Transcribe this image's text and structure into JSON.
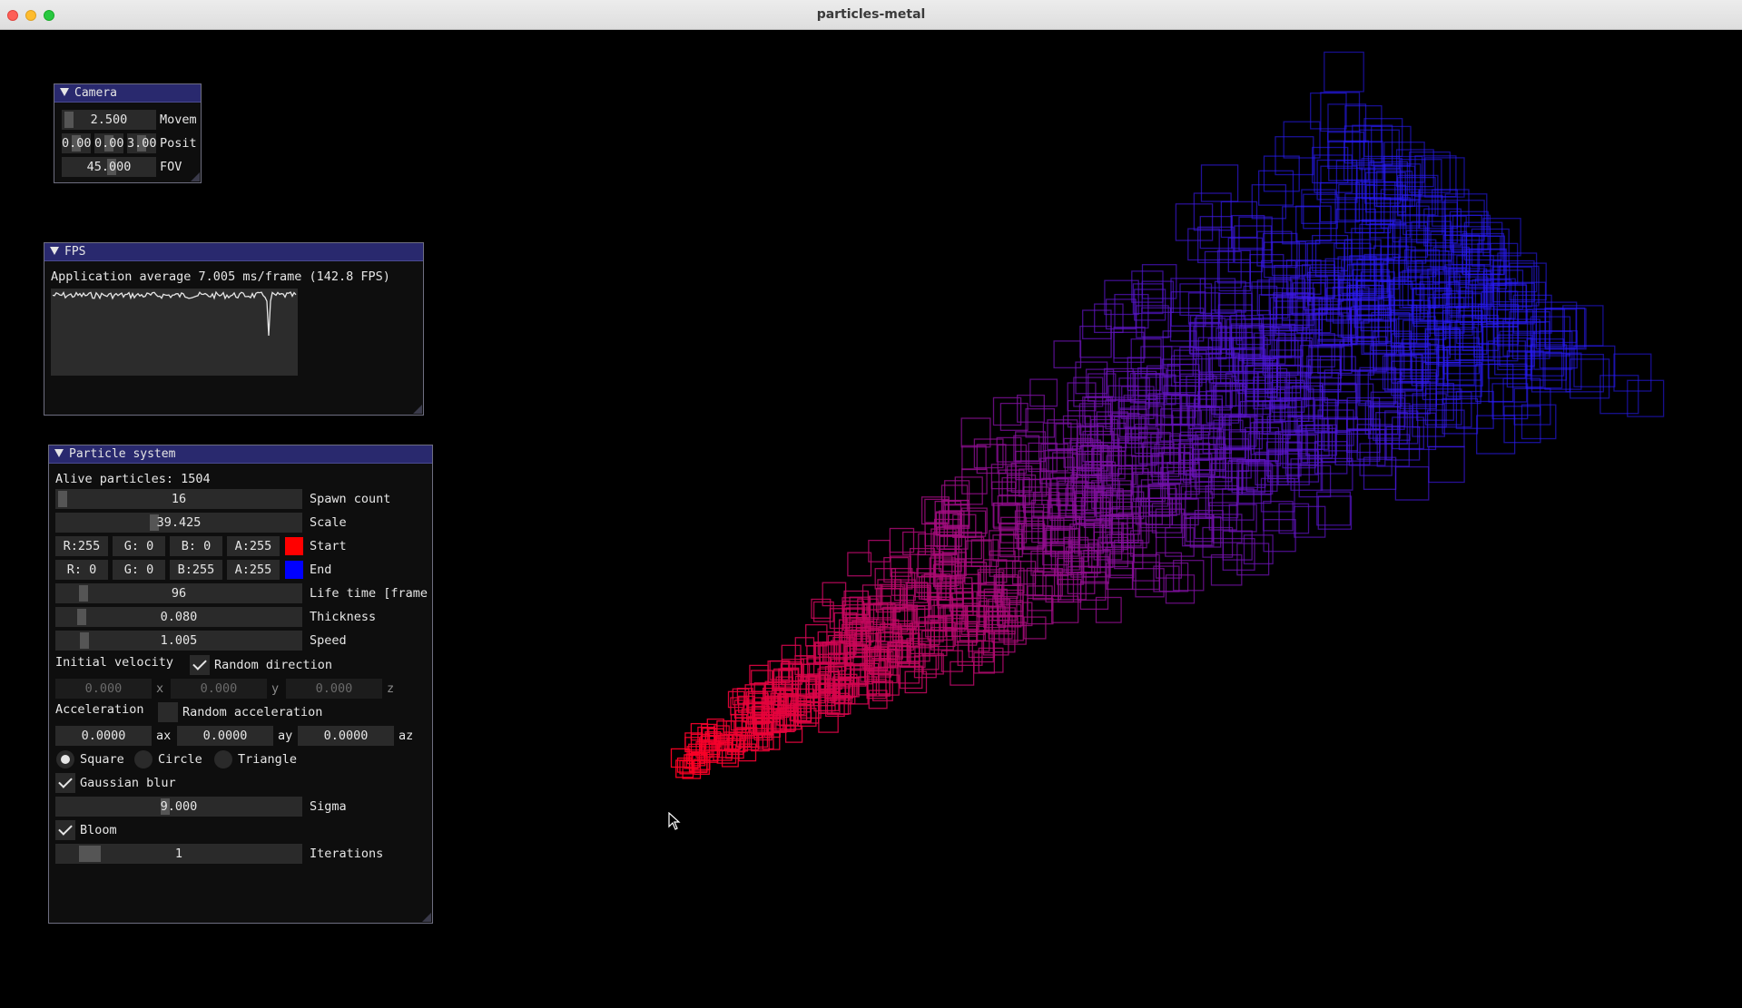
{
  "window": {
    "title": "particles-metal"
  },
  "camera": {
    "title": "Camera",
    "movement": {
      "value": "2.500",
      "label": "Movem"
    },
    "position": {
      "values": [
        "0.000",
        "0.000",
        "3.000"
      ],
      "label": "Posit"
    },
    "fov": {
      "value": "45.000",
      "label": "FOV"
    }
  },
  "fps": {
    "title": "FPS",
    "average_text": "Application average 7.005 ms/frame (142.8 FPS)"
  },
  "particles": {
    "title": "Particle system",
    "alive_text": "Alive particles: 1504",
    "spawn_count": {
      "value": "16",
      "label": "Spawn count"
    },
    "scale": {
      "value": "39.425",
      "label": "Scale"
    },
    "start_color": {
      "r": "R:255",
      "g": "G:  0",
      "b": "B:  0",
      "a": "A:255",
      "label": "Start",
      "swatch": "#ff0000"
    },
    "end_color": {
      "r": "R:  0",
      "g": "G:  0",
      "b": "B:255",
      "a": "A:255",
      "label": "End",
      "swatch": "#0000ff"
    },
    "lifetime": {
      "value": "96",
      "label": "Life time [frame"
    },
    "thickness": {
      "value": "0.080",
      "label": "Thickness"
    },
    "speed": {
      "value": "1.005",
      "label": "Speed"
    },
    "initial_velocity": {
      "label": "Initial velocity",
      "random_label": "Random direction",
      "random_checked": true,
      "x": "0.000",
      "x_label": "x",
      "y": "0.000",
      "y_label": "y",
      "z": "0.000",
      "z_label": "z"
    },
    "acceleration": {
      "label": "Acceleration",
      "random_label": "Random acceleration",
      "random_checked": false,
      "ax": "0.0000",
      "ax_label": "ax",
      "ay": "0.0000",
      "ay_label": "ay",
      "az": "0.0000",
      "az_label": "az"
    },
    "shapes": {
      "square": "Square",
      "circle": "Circle",
      "triangle": "Triangle",
      "selected": "square"
    },
    "gaussian_blur": {
      "label": "Gaussian blur",
      "checked": true
    },
    "sigma": {
      "value": "9.000",
      "label": "Sigma"
    },
    "bloom": {
      "label": "Bloom",
      "checked": true
    },
    "iterations": {
      "value": "1",
      "label": "Iterations"
    }
  },
  "colors": {
    "particle_start": "#ff0022",
    "particle_end": "#2a1cff",
    "title_bg": "#29296e"
  }
}
